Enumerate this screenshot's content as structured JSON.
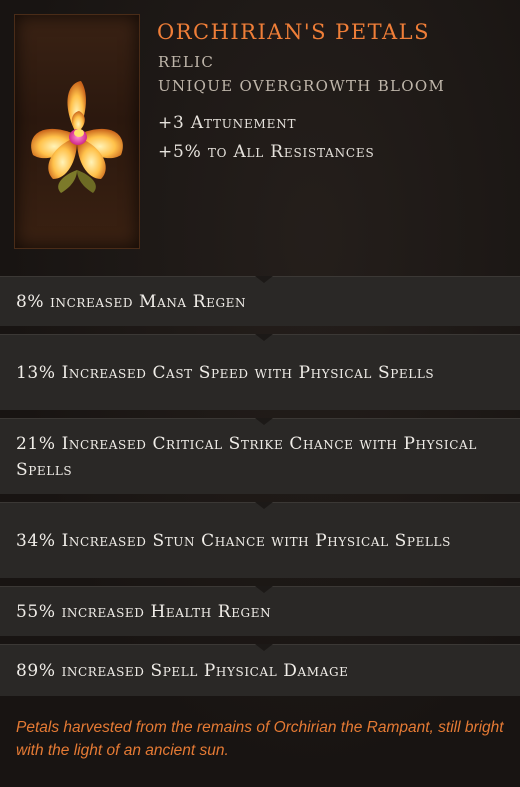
{
  "item": {
    "name": "Orchirian's Petals",
    "type_line": "Relic",
    "subtype_line": "Unique Overgrowth Bloom",
    "icon": "orchid-flower-icon",
    "implicits": [
      "+3 Attunement",
      "+5% to All Resistances"
    ]
  },
  "affixes": [
    "8% increased Mana Regen",
    "13% Increased Cast Speed with Physical Spells",
    "21% Increased Critical Strike Chance with Physical Spells",
    "34% Increased Stun Chance with Physical Spells",
    "55% increased Health Regen",
    "89% increased Spell Physical Damage"
  ],
  "lore": "Petals harvested from the remains of Orchirian the Rampant, still bright with the light of an ancient sun.",
  "colors": {
    "name": "#ef7e38",
    "lore": "#e57a34",
    "affix_bg": "#2a2826",
    "background": "#181412"
  }
}
